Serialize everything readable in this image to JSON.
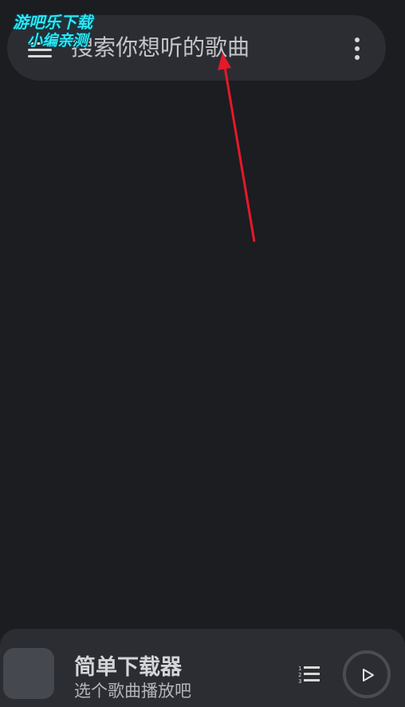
{
  "search": {
    "placeholder": "搜索你想听的歌曲",
    "menu_icon": "hamburger-menu-icon",
    "more_icon": "more-vertical-icon"
  },
  "watermark": {
    "line1": "游吧乐下载",
    "line2": "小编亲测"
  },
  "annotation": {
    "arrow_color": "#e8182a"
  },
  "player": {
    "title": "简单下载器",
    "subtitle": "选个歌曲播放吧",
    "playlist_icon": "playlist-icon",
    "play_icon": "play-icon"
  },
  "colors": {
    "background": "#1c1d21",
    "surface": "#2b2d33",
    "watermark": "#2ee6f2"
  }
}
